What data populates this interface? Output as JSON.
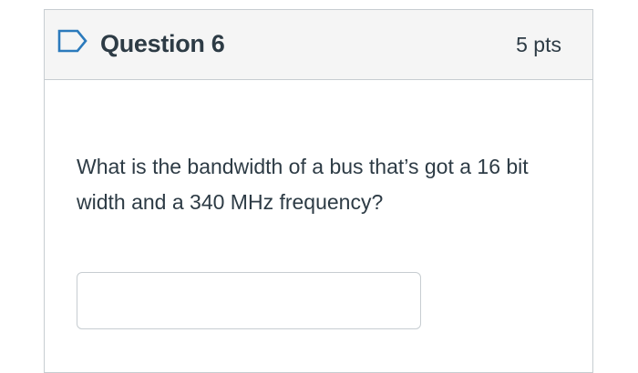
{
  "question": {
    "title": "Question 6",
    "points": "5 pts",
    "text": "What is the bandwidth of a bus that’s got a 16 bit width and a 340 MHz frequency?",
    "flag_icon": "flag-outline-icon",
    "answer": {
      "value": "",
      "placeholder": ""
    }
  },
  "colors": {
    "text": "#2d3b45",
    "border": "#c7cdd1",
    "header_bg": "#f5f5f5",
    "flag_stroke": "#2b7abc"
  }
}
